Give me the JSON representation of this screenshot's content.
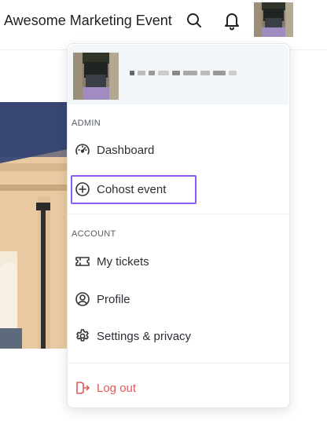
{
  "header": {
    "event_title": "Awesome Marketing Event",
    "icons": [
      "search-icon",
      "bell-icon",
      "user-avatar"
    ]
  },
  "menu": {
    "admin_label": "ADMIN",
    "admin_items": [
      {
        "label": "Dashboard",
        "icon": "speedometer-icon"
      },
      {
        "label": "Cohost event",
        "icon": "plus-circle-icon"
      }
    ],
    "account_label": "ACCOUNT",
    "account_items": [
      {
        "label": "My tickets",
        "icon": "ticket-icon"
      },
      {
        "label": "Profile",
        "icon": "user-circle-icon"
      },
      {
        "label": "Settings & privacy",
        "icon": "gear-icon"
      }
    ],
    "logout": {
      "label": "Log out",
      "icon": "logout-icon"
    }
  },
  "colors": {
    "highlight_border": "#8b5cf6",
    "logout": "#e05a5a",
    "user_card_bg": "#f3f6f9"
  }
}
